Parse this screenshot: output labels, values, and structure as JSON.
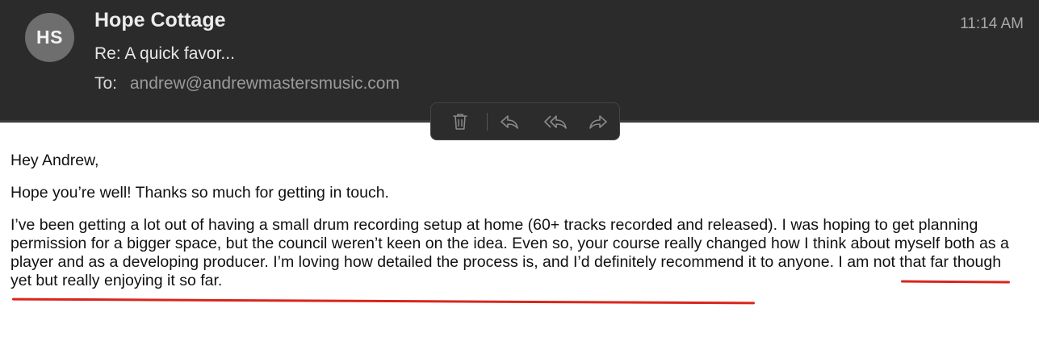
{
  "header": {
    "avatar_initials": "HS",
    "sender_name": "Hope Cottage",
    "subject": "Re: A quick favor...",
    "to_label": "To:",
    "to_address": "andrew@andrewmastersmusic.com",
    "time": "11:14 AM"
  },
  "toolbar": {
    "buttons": [
      {
        "name": "trash-icon"
      },
      {
        "name": "reply-icon"
      },
      {
        "name": "reply-all-icon"
      },
      {
        "name": "forward-icon"
      }
    ]
  },
  "message": {
    "greeting": "Hey Andrew,",
    "paragraph_1": "Hope you’re well! Thanks so much for getting in touch.",
    "paragraph_2": {
      "part_1": "I’ve been getting a lot out of having a small drum recording setup at home (60+ tracks recorded and released). I was hoping to get planning permission for a bigger space, but the council weren’t keen on the idea. Even so, ",
      "highlight": "your course really changed how I think about myself both as a player and as a developing producer",
      "part_2": ". I’m loving how detailed the process is, and I’d definitely recommend it to anyone. I am not that far though yet but really enjoying it so far."
    }
  },
  "colors": {
    "header_bg": "#2b2b2b",
    "annotation_red": "#d9261c"
  }
}
